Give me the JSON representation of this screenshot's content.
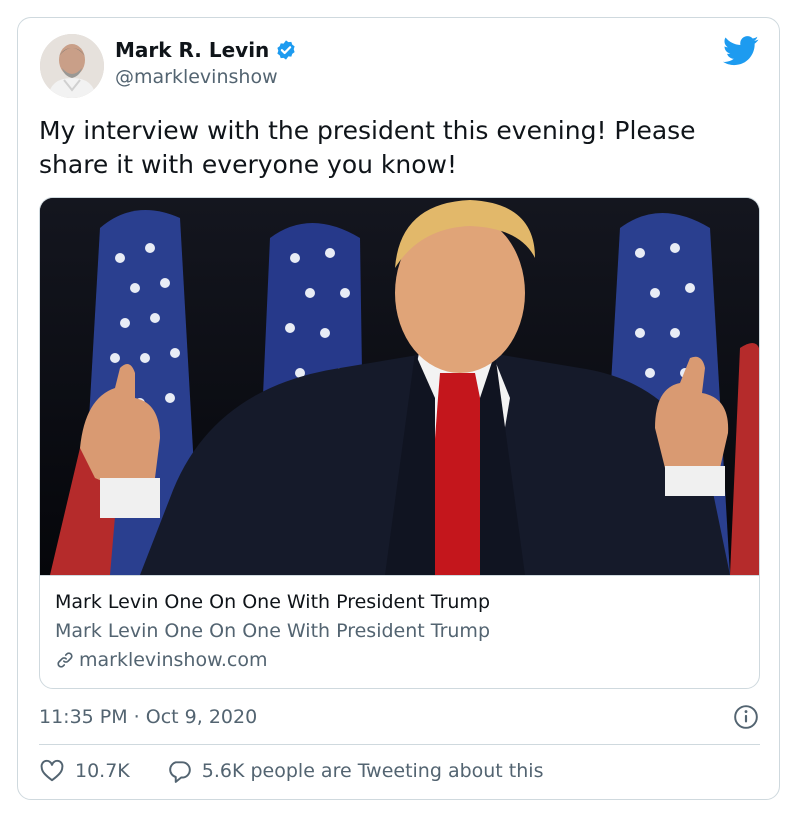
{
  "author": {
    "name": "Mark R. Levin",
    "handle": "@marklevinshow",
    "verified": true,
    "avatar_icon": "avatar-photo"
  },
  "platform_icon": "twitter-bird-icon",
  "tweet": {
    "text": "My interview with the president this evening!  Please share it with everyone you know!"
  },
  "card": {
    "image_icon": "man-thumbs-up-flags-photo",
    "title": "Mark Levin One On One With President Trump",
    "description": "Mark Levin One On One With President Trump",
    "domain": "marklevinshow.com"
  },
  "meta": {
    "timestamp": "11:35 PM · Oct 9, 2020"
  },
  "actions": {
    "likes": "10.7K",
    "tweeting": "5.6K people are Tweeting about this"
  },
  "colors": {
    "brand_blue": "#1d9bf0",
    "text_primary": "#0f1419",
    "text_secondary": "#536471",
    "border": "#cfd9de"
  }
}
